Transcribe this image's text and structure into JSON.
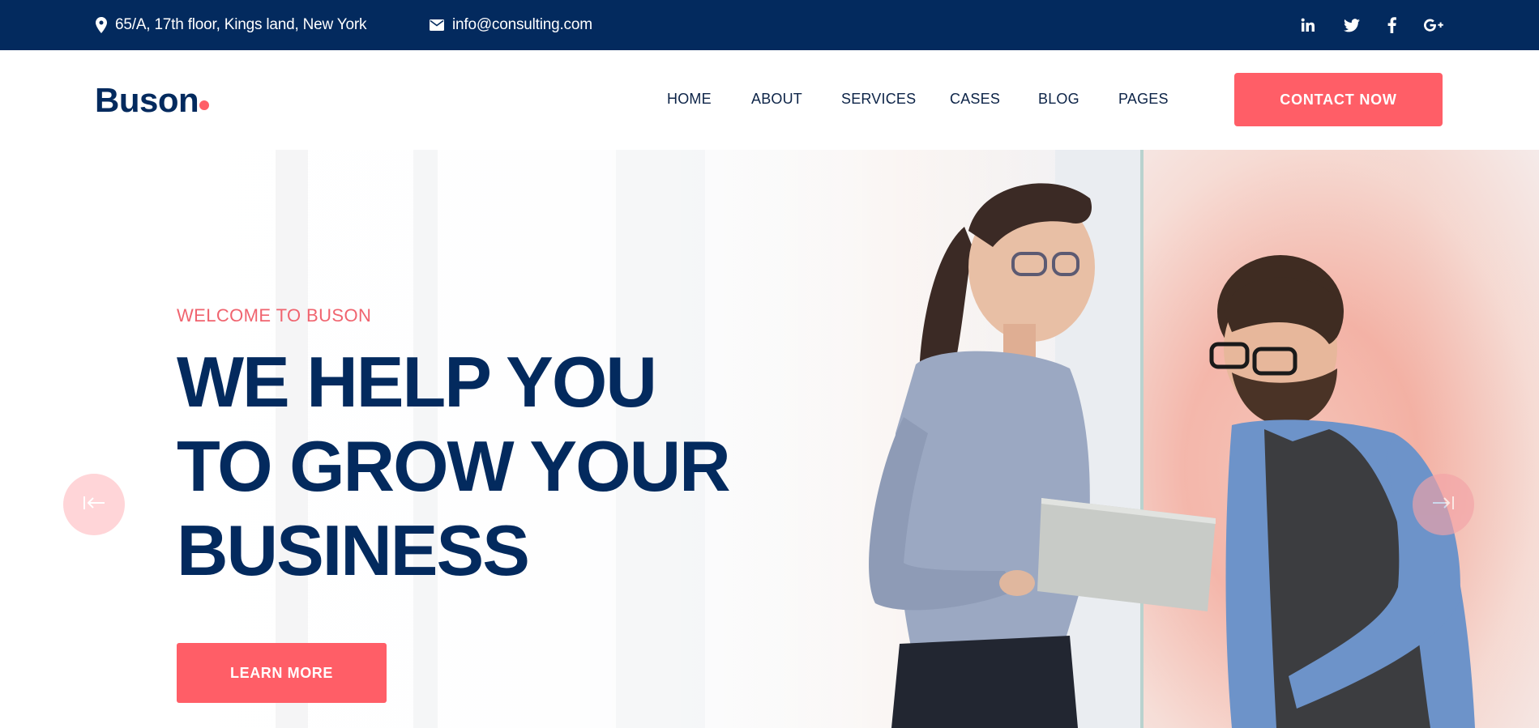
{
  "topbar": {
    "address": "65/A, 17th floor, Kings land, New York",
    "email": "info@consulting.com",
    "social": [
      {
        "name": "linkedin-icon",
        "glyph": "in"
      },
      {
        "name": "twitter-icon",
        "glyph": "🐦"
      },
      {
        "name": "facebook-icon",
        "glyph": "f"
      },
      {
        "name": "google-plus-icon",
        "glyph": "G+"
      }
    ]
  },
  "header": {
    "logo": "Buson",
    "nav": [
      "HOME",
      "ABOUT",
      "SERVICES",
      "CASES",
      "BLOG",
      "PAGES"
    ],
    "cta": "CONTACT NOW"
  },
  "hero": {
    "welcome": "WELCOME TO BUSON",
    "headline": [
      "WE HELP YOU",
      "TO GROW YOUR",
      "BUSINESS"
    ],
    "button": "LEARN MORE"
  },
  "colors": {
    "navy": "#032a5e",
    "accent": "#ff5e67",
    "accent_text": "#f0646f"
  }
}
